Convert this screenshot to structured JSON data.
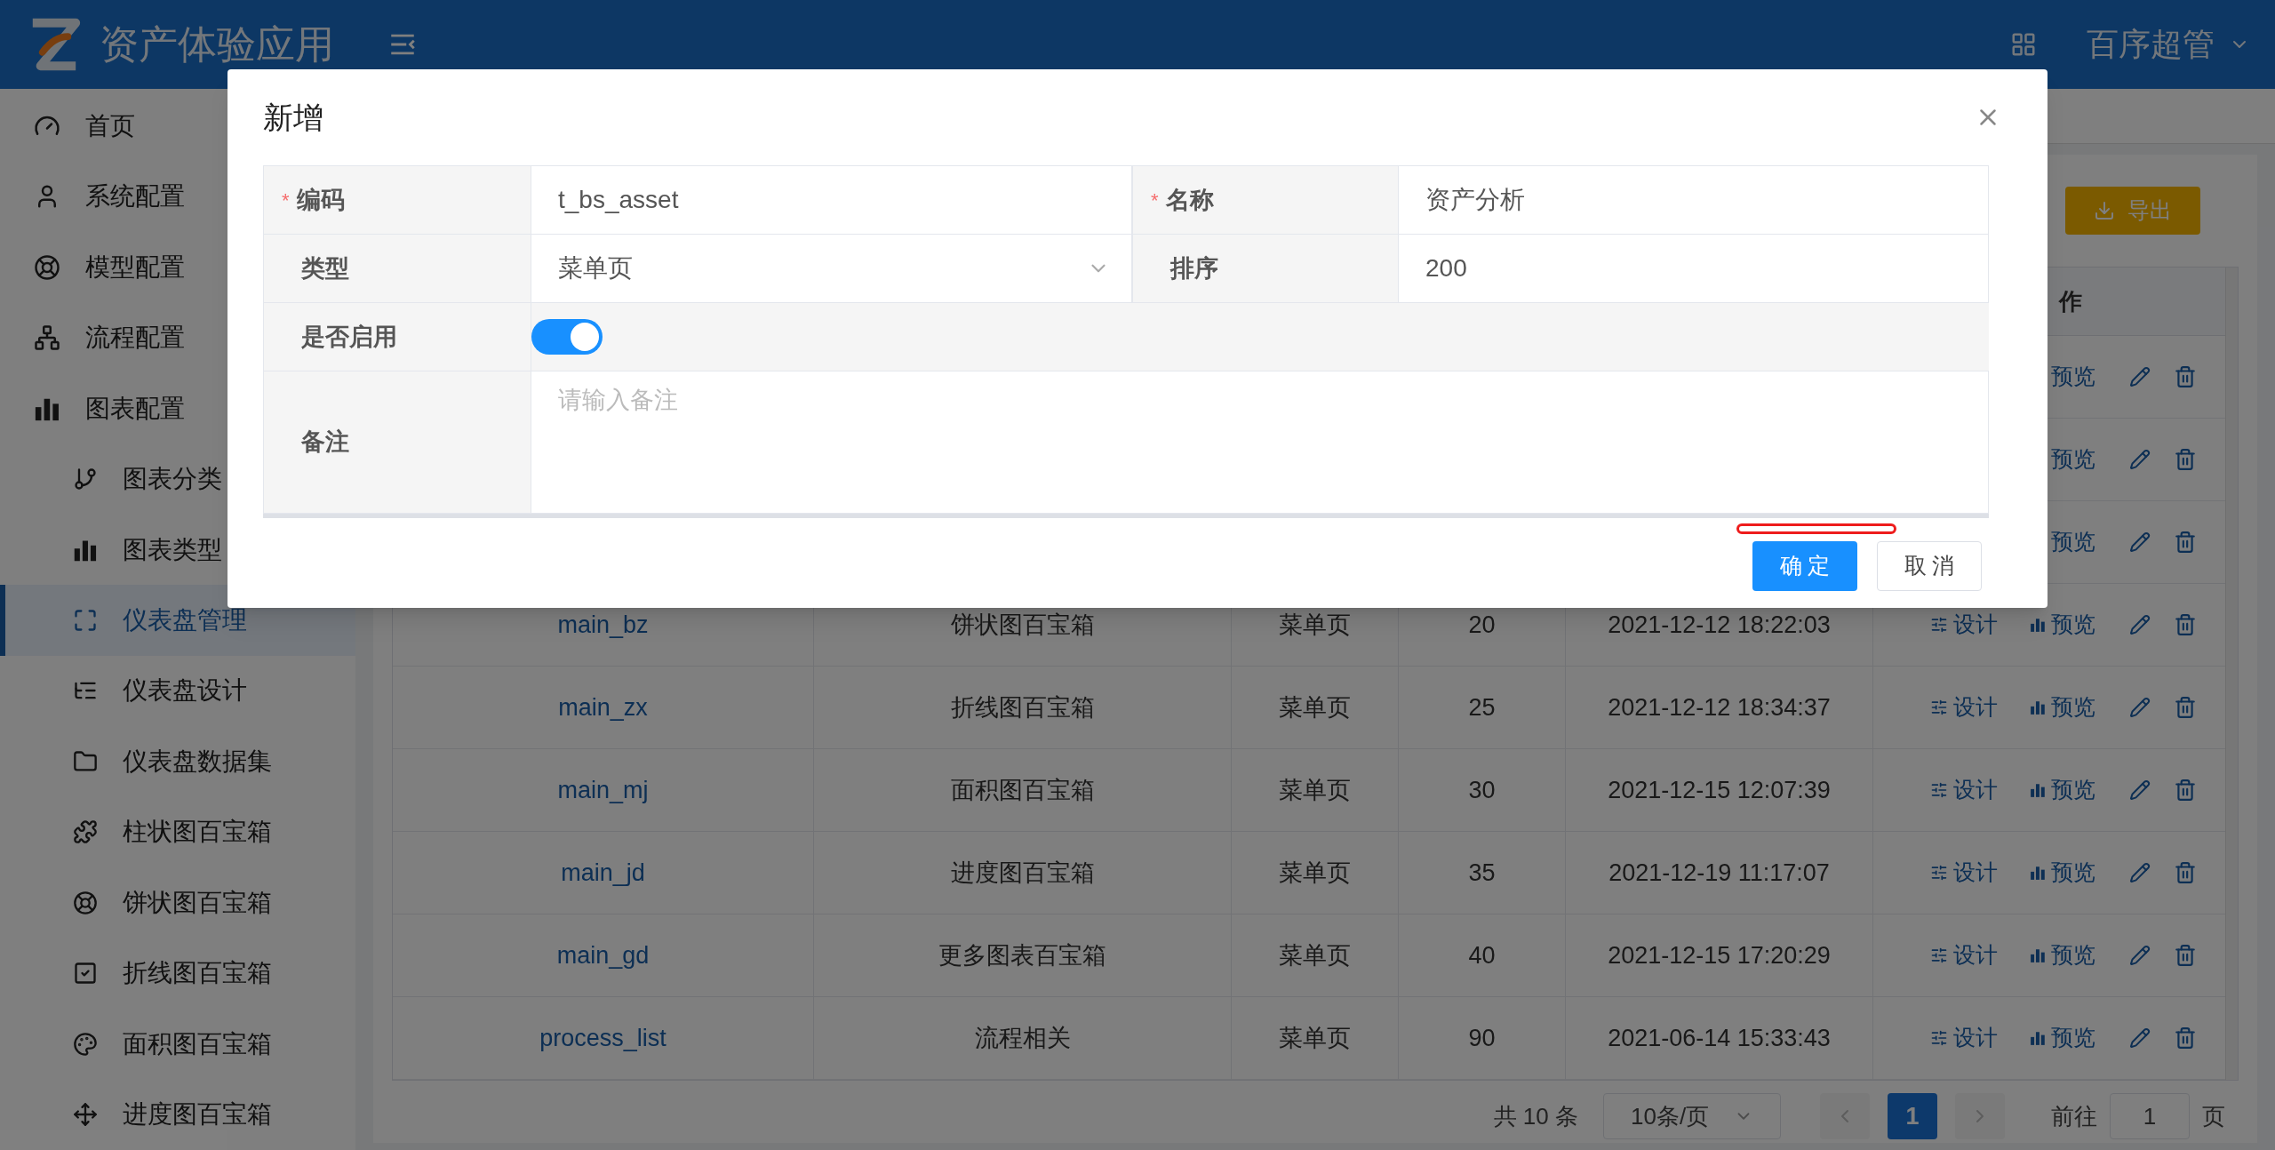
{
  "header": {
    "title": "资产体验应用",
    "user": "百序超管"
  },
  "sidebar": {
    "items": [
      {
        "label": "首页",
        "selected": false
      },
      {
        "label": "系统配置",
        "selected": false
      },
      {
        "label": "模型配置",
        "selected": false
      },
      {
        "label": "流程配置",
        "selected": false
      },
      {
        "label": "图表配置",
        "selected": false,
        "children": [
          {
            "label": "图表分类",
            "selected": false
          },
          {
            "label": "图表类型",
            "selected": false
          },
          {
            "label": "仪表盘管理",
            "selected": true
          },
          {
            "label": "仪表盘设计",
            "selected": false
          },
          {
            "label": "仪表盘数据集",
            "selected": false
          },
          {
            "label": "柱状图百宝箱",
            "selected": false
          },
          {
            "label": "饼状图百宝箱",
            "selected": false
          },
          {
            "label": "折线图百宝箱",
            "selected": false
          },
          {
            "label": "面积图百宝箱",
            "selected": false
          },
          {
            "label": "进度图百宝箱",
            "selected": false
          }
        ]
      }
    ]
  },
  "toolbar": {
    "export_button": "导出"
  },
  "table": {
    "ops_header": "作",
    "rows": [
      {
        "preview": "预览"
      },
      {
        "preview": "预览"
      },
      {
        "preview": "预览"
      },
      {
        "code": "main_bz",
        "name": "饼状图百宝箱",
        "type": "菜单页",
        "sort": "20",
        "time": "2021-12-12 18:22:03",
        "design": "设计",
        "preview": "预览"
      },
      {
        "code": "main_zx",
        "name": "折线图百宝箱",
        "type": "菜单页",
        "sort": "25",
        "time": "2021-12-12 18:34:37",
        "design": "设计",
        "preview": "预览"
      },
      {
        "code": "main_mj",
        "name": "面积图百宝箱",
        "type": "菜单页",
        "sort": "30",
        "time": "2021-12-15 12:07:39",
        "design": "设计",
        "preview": "预览"
      },
      {
        "code": "main_jd",
        "name": "进度图百宝箱",
        "type": "菜单页",
        "sort": "35",
        "time": "2021-12-19 11:17:07",
        "design": "设计",
        "preview": "预览"
      },
      {
        "code": "main_gd",
        "name": "更多图表百宝箱",
        "type": "菜单页",
        "sort": "40",
        "time": "2021-12-15 17:20:29",
        "design": "设计",
        "preview": "预览"
      },
      {
        "code": "process_list",
        "name": "流程相关",
        "type": "菜单页",
        "sort": "90",
        "time": "2021-06-14 15:33:43",
        "design": "设计",
        "preview": "预览"
      }
    ]
  },
  "pagination": {
    "total": "共 10 条",
    "page_size": "10条/页",
    "pages": [
      {
        "label": "1",
        "selected": true
      }
    ],
    "goto_label": "前往",
    "goto_value": "1",
    "page_suffix": "页"
  },
  "dialog": {
    "title": "新增",
    "fields": [
      {
        "kind": "text",
        "label": "编码",
        "required_mark": "*",
        "value": "t_bs_asset"
      },
      {
        "kind": "text",
        "label": "名称",
        "required_mark": "*",
        "value": "资产分析"
      },
      {
        "kind": "select",
        "label": "类型",
        "value": "菜单页"
      },
      {
        "kind": "text",
        "label": "排序",
        "value": "200"
      },
      {
        "kind": "switch",
        "label": "是否启用",
        "on": true
      },
      {
        "kind": "textarea",
        "label": "备注",
        "placeholder": "请输入备注"
      }
    ],
    "buttons": [
      {
        "kind": "primary",
        "label": "确 定"
      },
      {
        "kind": "default",
        "label": "取 消"
      }
    ]
  }
}
